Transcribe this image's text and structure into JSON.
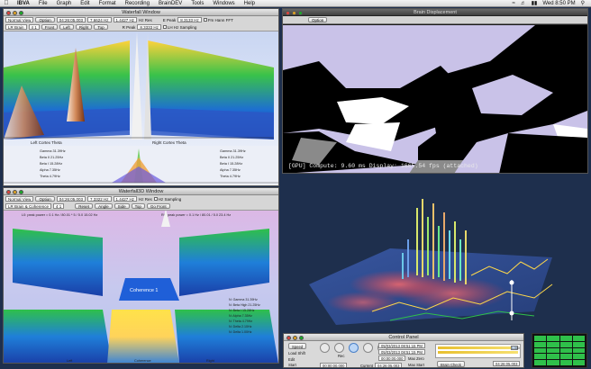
{
  "menubar": {
    "app": "IBVA",
    "items": [
      "File",
      "Graph",
      "Edit",
      "Format",
      "Recording",
      "BrainDEV",
      "Tools",
      "Windows",
      "Help"
    ],
    "clock": "Wed 8:50 PM"
  },
  "waterfall": {
    "title": "Waterfall Window",
    "view_select": "Normal View",
    "option_label": "Option",
    "field1": "04:26:05.003",
    "field2": "7.6624 Hz",
    "field3": "1.4427 Hz",
    "field3_unit": "Hz Res",
    "channel_select": "LR Brain",
    "chan_num": "4 1",
    "nav_buttons": [
      "Front",
      "Left",
      "Right",
      "Top"
    ],
    "peak_label": "E Peak",
    "peak_value": "8.3133 Hz",
    "rpeak_label": "R Peak",
    "rpeak_value": "8.3333 Hz",
    "chk1": "Fm Hann FFT",
    "chk2": "LH Hz Sampling",
    "axis_left": "Left Cortex Theta",
    "axis_right": "Right Cortex Theta",
    "bands_left": [
      "Gamma 31.39Hz",
      "Beta II 21.25Hz",
      "Beta I 15.28Hz",
      "Alpha 7.35Hz",
      "Theta 4.79Hz"
    ],
    "bands_right": [
      "Gamma 31.39Hz",
      "Beta II 21.25Hz",
      "Beta I 15.28Hz",
      "Alpha 7.35Hz",
      "Theta 4.79Hz"
    ]
  },
  "waterfall3d": {
    "title": "Waterfall3D Window",
    "view_select": "Normal View",
    "option_label": "Option",
    "field1": "04:26:05.003",
    "field2": "7.3322 Hz",
    "field3": "1.4427 Hz",
    "field3_unit": "Hz Res",
    "channel_select": "LR Brain & Coherence",
    "chan_num": "4 1",
    "nav_buttons": [
      "Reset",
      "Angle",
      "Side",
      "Top",
      "Go Front"
    ],
    "chk2": "Hz Sampling",
    "info_left": "L0: peak power = 0.1 Hz / 80.01 * 5 / 5.0 15.02 Hz",
    "info_right": "R0: peak power = 0.1 Hz / 80.01 / 5.0 23.4 Hz",
    "coherence_label": "Coherence 1",
    "bands": [
      "N: Gamma 31.39Hz",
      "N: Beta High 21.25Hz",
      "N: Beta I 15.28Hz",
      "N: Alpha 7.35Hz",
      "N: Theta 4.79Hz",
      "N: Delta 2.10Hz",
      "N: Delta 1.00Hz"
    ],
    "bottom_left": "Left",
    "bottom_center": "Coherence",
    "bottom_right": "Right"
  },
  "brain_displacement": {
    "title": "Brain Displacement",
    "option_label": "Option",
    "status": "[GPU] Compute: 9.60 ms  Display: 1665.54 fps (attached)"
  },
  "control_panel": {
    "title": "Control Panel",
    "speed_label": "Speed",
    "load_label": "Load Shift",
    "play_label": "Rec",
    "edit_label": "Edit",
    "start_label": "Start",
    "date1": "05/03/2013 08:51:15 PM",
    "date2": "05/03/2013 08:51:15 PM",
    "t1": "00:00:00.000",
    "t2": "00:00:00.000",
    "maxzero_label": "Max Zero",
    "maxstart_label": "Max Start",
    "current_label": "Current",
    "current_value": "04:26:05.003",
    "start_time": "00:00:00.000",
    "end_time": "04:26:05.003",
    "brain_check": "Brain Check",
    "rate": "1.000"
  },
  "colors": {
    "desktop": "#1e2f4d",
    "accent_blue": "#1f5fd8",
    "surface_green": "#2fc04a",
    "peak_orange": "#e07a3a"
  }
}
